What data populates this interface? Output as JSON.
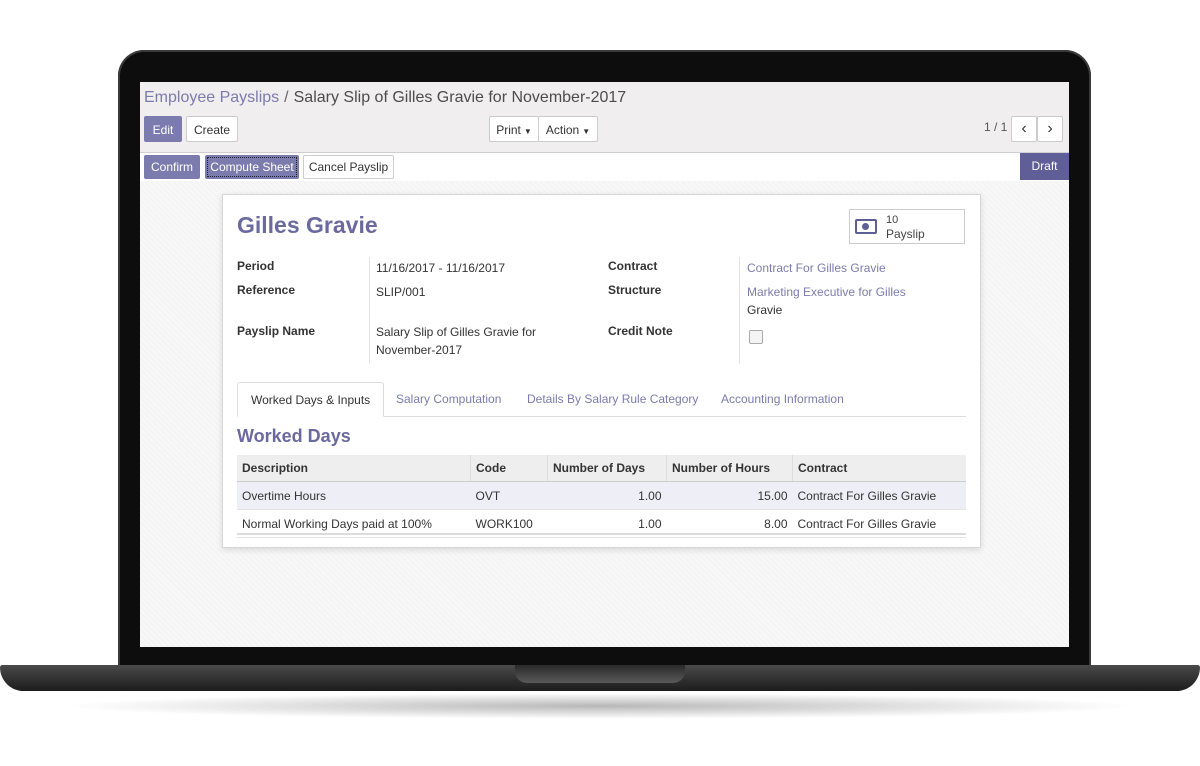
{
  "breadcrumb": {
    "parent": "Employee Payslips",
    "separator": "/",
    "current": "Salary Slip of Gilles Gravie for November-2017"
  },
  "toolbar": {
    "edit": "Edit",
    "create": "Create",
    "print": "Print",
    "action": "Action",
    "pager": "1 / 1"
  },
  "statusbar": {
    "confirm": "Confirm",
    "compute": "Compute Sheet",
    "cancel": "Cancel Payslip",
    "state": "Draft"
  },
  "employee": {
    "name": "Gilles Gravie"
  },
  "stat_button": {
    "count": "10",
    "label": "Payslip"
  },
  "fields": {
    "period_label": "Period",
    "period_value": "11/16/2017 - 11/16/2017",
    "reference_label": "Reference",
    "reference_value": "SLIP/001",
    "payslip_name_label": "Payslip Name",
    "payslip_name_line1": "Salary Slip of Gilles Gravie for",
    "payslip_name_line2": "November-2017",
    "contract_label": "Contract",
    "contract_value": "Contract For Gilles Gravie",
    "structure_label": "Structure",
    "structure_line1": "Marketing Executive for Gilles",
    "structure_line2": "Gravie",
    "credit_note_label": "Credit Note",
    "credit_note_checked": false
  },
  "tabs": [
    "Worked Days & Inputs",
    "Salary Computation",
    "Details By Salary Rule Category",
    "Accounting Information"
  ],
  "section_title": "Worked Days",
  "table": {
    "headers": [
      "Description",
      "Code",
      "Number of Days",
      "Number of Hours",
      "Contract"
    ],
    "rows": [
      [
        "Overtime Hours",
        "OVT",
        "1.00",
        "15.00",
        "Contract For Gilles Gravie"
      ],
      [
        "Normal Working Days paid at 100%",
        "WORK100",
        "1.00",
        "8.00",
        "Contract For Gilles Gravie"
      ]
    ]
  },
  "colors": {
    "primary": "#7c7bad",
    "draft_state": "#5f5e97",
    "title": "#6a6a9e"
  },
  "icons": {
    "prev": "chevron-left-icon",
    "next": "chevron-right-icon",
    "stat": "money-icon"
  }
}
